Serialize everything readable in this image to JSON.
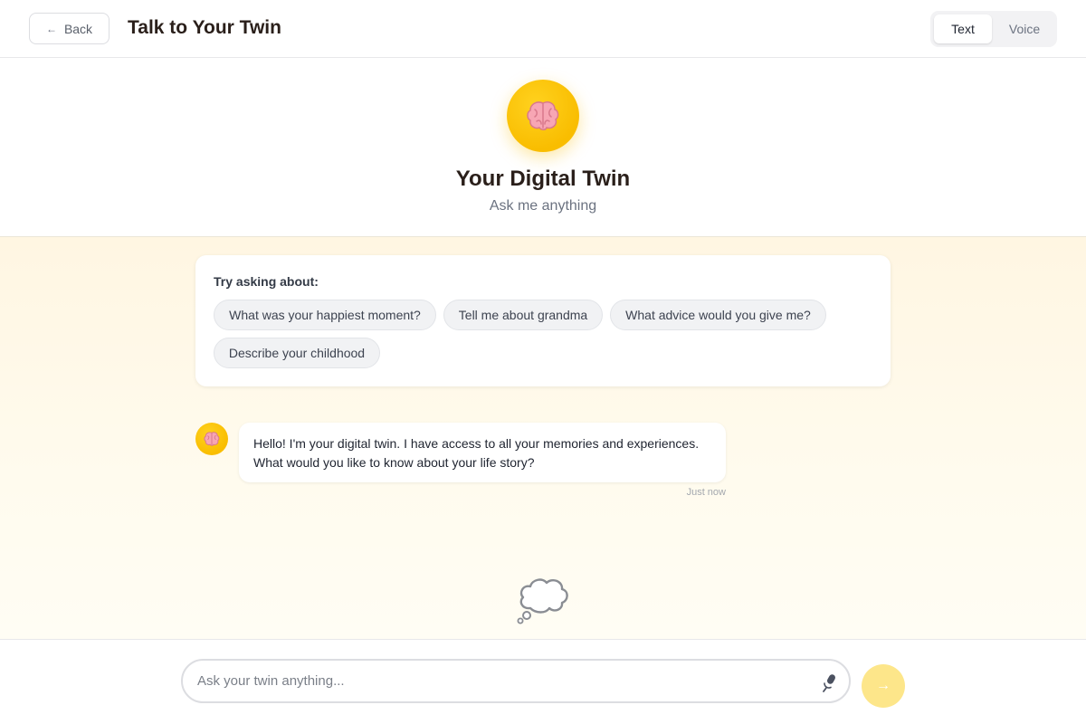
{
  "header": {
    "back_label": "Back",
    "back_arrow": "←",
    "title": "Talk to Your Twin",
    "modes": [
      {
        "label": "Text",
        "active": true
      },
      {
        "label": "Voice",
        "active": false
      }
    ]
  },
  "hero": {
    "avatar_icon": "brain-icon",
    "title": "Your Digital Twin",
    "subtitle": "Ask me anything"
  },
  "suggestions": {
    "title": "Try asking about:",
    "chips": [
      "What was your happiest moment?",
      "Tell me about grandma",
      "What advice would you give me?",
      "Describe your childhood"
    ]
  },
  "messages": [
    {
      "sender": "twin",
      "avatar_icon": "brain-icon",
      "text": "Hello! I'm your digital twin. I have access to all your memories and experiences. What would you like to know about your life story?",
      "time": "Just now"
    }
  ],
  "thinking_icon": "thought-bubble-icon",
  "composer": {
    "placeholder": "Ask your twin anything...",
    "value": "",
    "mic_icon": "microphone-icon",
    "send_icon": "arrow-right-icon",
    "send_glyph": "→"
  },
  "colors": {
    "accent": "#f9bd00",
    "send_disabled": "#fde68a",
    "chat_bg": "#fff8e7"
  }
}
